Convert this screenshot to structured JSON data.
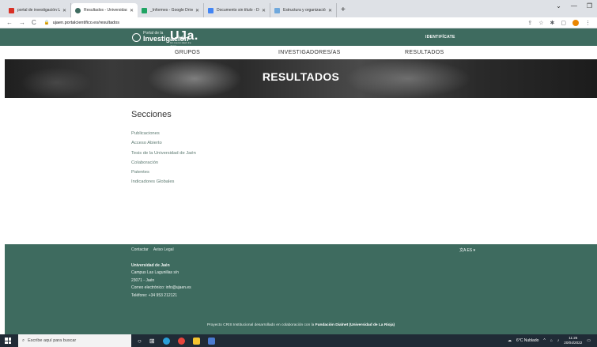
{
  "browser": {
    "tabs": [
      {
        "title": "portal de investigación UJA - ins",
        "color": "#d93025"
      },
      {
        "title": "Resultados - Universidad de Jaén",
        "color": "#3e6b5f",
        "active": true
      },
      {
        "title": "_Informes - Google Drive",
        "color": "#1fa463"
      },
      {
        "title": "Documento sin título - Docume",
        "color": "#4285f4"
      },
      {
        "title": "Estructura y organización - UPO",
        "color": "#6fa8dc"
      }
    ],
    "new_tab_label": "+",
    "url": "ujaen.portalcientifico.es/resultados"
  },
  "header": {
    "portal_small": "Portal de la",
    "portal_big": "Investigación",
    "uja_logo": "UJa.",
    "uja_sub": "Universidad de Jaén",
    "identify": "IDENTIFÍCATE"
  },
  "nav": {
    "grupos": "GRUPOS",
    "investigadores": "INVESTIGADORES/AS",
    "resultados": "RESULTADOS"
  },
  "hero": {
    "title": "RESULTADOS"
  },
  "main": {
    "heading": "Secciones",
    "sections": [
      "Publicaciones",
      "Acceso Abierto",
      "Tesis de la Universidad de Jaén",
      "Colaboración",
      "Patentes",
      "Indicadores Globales"
    ]
  },
  "footer": {
    "contact": "Contactar",
    "legal": "Aviso Legal",
    "lang": "ES",
    "university": "Universidad de Jaén",
    "address1": "Campus Las Lagunillas s/n",
    "address2": "23071 - Jaén",
    "email": "Correo electrónico: info@ujaen.es",
    "phone": "Teléfono: +34 953 212121",
    "project_prefix": "Proyecto CRIS Institucional desarrollado en colaboración con la",
    "project_bold": "Fundación Dialnet (Universidad de La Rioja)"
  },
  "taskbar": {
    "search_placeholder": "Escribe aquí para buscar",
    "weather": "6°C  Nublado",
    "time": "11:25",
    "date": "20/04/2022"
  }
}
